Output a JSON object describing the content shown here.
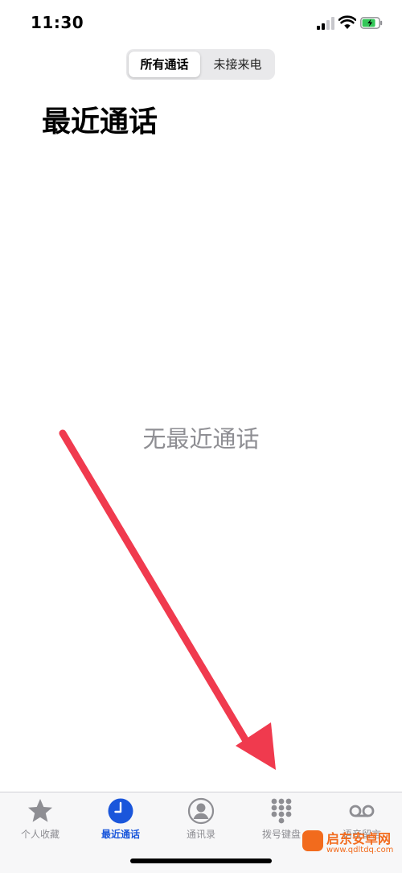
{
  "status_bar": {
    "time": "11:30"
  },
  "segmented_control": {
    "all_calls": "所有通话",
    "missed": "未接来电"
  },
  "page": {
    "title": "最近通话",
    "empty_message": "无最近通话"
  },
  "tab_bar": {
    "items": [
      {
        "label": "个人收藏",
        "icon": "star-icon"
      },
      {
        "label": "最近通话",
        "icon": "clock-icon",
        "active": true
      },
      {
        "label": "通讯录",
        "icon": "person-circle-icon"
      },
      {
        "label": "拨号键盘",
        "icon": "keypad-icon"
      },
      {
        "label": "语音留言",
        "icon": "voicemail-icon"
      }
    ]
  },
  "watermark": {
    "title": "启东安卓网",
    "url": "www.qdltdq.com"
  },
  "colors": {
    "accent": "#1a56db",
    "arrow": "#f03a4e",
    "battery": "#34c759",
    "inactive": "#8e8e93",
    "watermark": "#f26b1d"
  }
}
